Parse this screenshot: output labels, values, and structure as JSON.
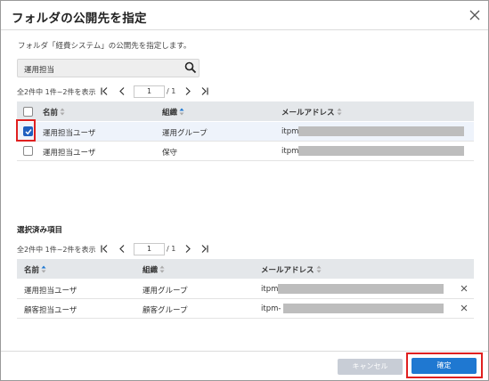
{
  "dialog": {
    "title": "フォルダの公開先を指定",
    "description": "フォルダ「経費システム」の公開先を指定します。"
  },
  "search": {
    "value": "運用担当"
  },
  "top_table": {
    "pager": {
      "count": "全2件中 1件~2件を表示",
      "page": "1",
      "total": "/ 1"
    },
    "columns": {
      "name": "名前",
      "org": "組織",
      "email": "メールアドレス"
    },
    "rows": [
      {
        "name": "運用担当ユーザ",
        "org": "運用グループ",
        "email": "itpm",
        "checked": true
      },
      {
        "name": "運用担当ユーザ",
        "org": "保守",
        "email": "itpm",
        "checked": false
      }
    ]
  },
  "selected_section": {
    "title": "選択済み項目",
    "pager": {
      "count": "全2件中 1件~2件を表示",
      "page": "1",
      "total": "/ 1"
    },
    "columns": {
      "name": "名前",
      "org": "組織",
      "email": "メールアドレス"
    },
    "rows": [
      {
        "name": "運用担当ユーザ",
        "org": "運用グループ",
        "email": "itpm"
      },
      {
        "name": "顧客担当ユーザ",
        "org": "顧客グループ",
        "email": "itpm-"
      }
    ]
  },
  "footer": {
    "cancel": "キャンセル",
    "ok": "確定"
  },
  "colors": {
    "primary": "#1f78d1",
    "highlight": "#e02020",
    "header_bg": "#e4e7ea",
    "checked": "#1f5fbf"
  },
  "icons": [
    "close-icon",
    "search-icon",
    "first-page-icon",
    "prev-page-icon",
    "next-page-icon",
    "last-page-icon",
    "sort-icon",
    "remove-icon",
    "checkmark-icon"
  ]
}
